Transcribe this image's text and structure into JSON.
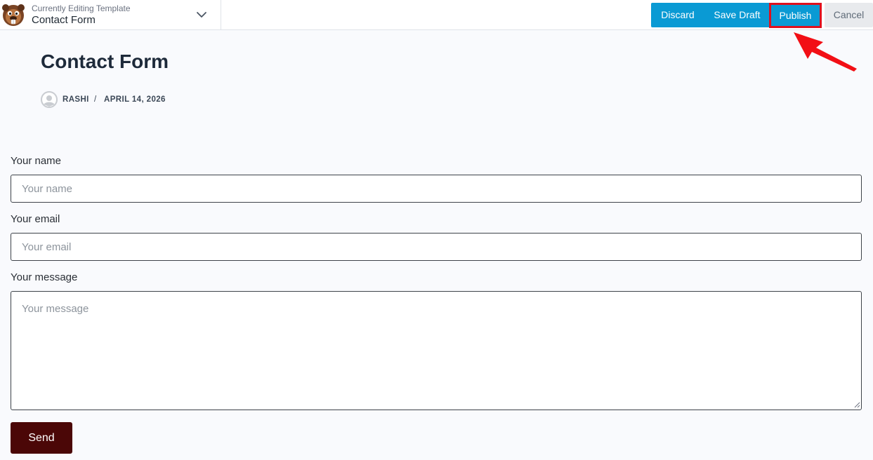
{
  "topbar": {
    "template_caption": "Currently Editing Template",
    "template_name": "Contact Form",
    "actions": {
      "discard": "Discard",
      "save_draft": "Save Draft",
      "publish": "Publish",
      "cancel": "Cancel"
    },
    "colors": {
      "primary": "#0a9ad4",
      "highlight": "#e0101d"
    }
  },
  "post": {
    "title": "Contact Form",
    "author": "RASHI",
    "separator": "/",
    "date": "APRIL 14, 2026"
  },
  "form": {
    "name_label": "Your name",
    "name_placeholder": "Your name",
    "email_label": "Your email",
    "email_placeholder": "Your email",
    "message_label": "Your message",
    "message_placeholder": "Your message",
    "submit_label": "Send",
    "submit_color": "#4b0707"
  }
}
